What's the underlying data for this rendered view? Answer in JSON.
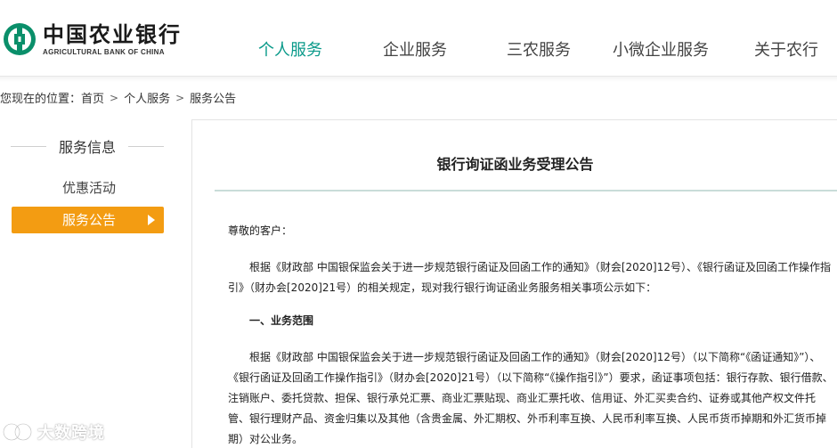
{
  "header": {
    "logo": {
      "name_cn": "中国农业银行",
      "name_en": "AGRICULTURAL BANK OF CHINA",
      "icon": "abc-coin-logo-icon"
    },
    "nav": [
      {
        "label": "个人服务",
        "active": true
      },
      {
        "label": "企业服务",
        "active": false
      },
      {
        "label": "三农服务",
        "active": false
      },
      {
        "label": "小微企业服务",
        "active": false
      },
      {
        "label": "关于农行",
        "active": false
      }
    ]
  },
  "breadcrumb": {
    "prefix": "您现在的位置：",
    "items": [
      "首页",
      "个人服务",
      "服务公告"
    ],
    "separator_icon": "chevron-right-icon"
  },
  "sidebar": {
    "title": "服务信息",
    "items": [
      {
        "label": "优惠活动",
        "active": false
      },
      {
        "label": "服务公告",
        "active": true
      }
    ],
    "active_arrow_icon": "triangle-right-icon"
  },
  "article": {
    "title": "银行询证函业务受理公告",
    "greeting": "尊敬的客户：",
    "paragraph1": "根据《财政部 中国银保监会关于进一步规范银行函证及回函工作的通知》（财会[2020]12号）、《银行函证及回函工作操作指引》（财办会[2020]21号）的相关规定，现对我行银行询证函业务服务相关事项公示如下：",
    "section1_heading": "一、业务范围",
    "paragraph2": "根据《财政部 中国银保监会关于进一步规范银行函证及回函工作的通知》（财会[2020]12号）（以下简称“《函证通知》”）、《银行函证及回函工作操作指引》（财办会[2020]21号）（以下简称“《操作指引》”）要求，函证事项包括：银行存款、银行借款、注销账户、委托贷款、担保、银行承兑汇票、商业汇票贴现、商业汇票托收、信用证、外汇买卖合约、证券或其他产权文件托管、银行理财产品、资金归集以及其他（含贵金属、外汇期权、外币利率互换、人民币利率互换、人民币货币掉期和外汇货币掉期）对公业务。"
  },
  "watermark": {
    "text": "大数跨境",
    "icon": "dashuju-logo-icon"
  },
  "colors": {
    "nav_active": "#0a9a8a",
    "sidebar_active_bg": "#f39c12",
    "logo_green": "#0a8f6a"
  }
}
